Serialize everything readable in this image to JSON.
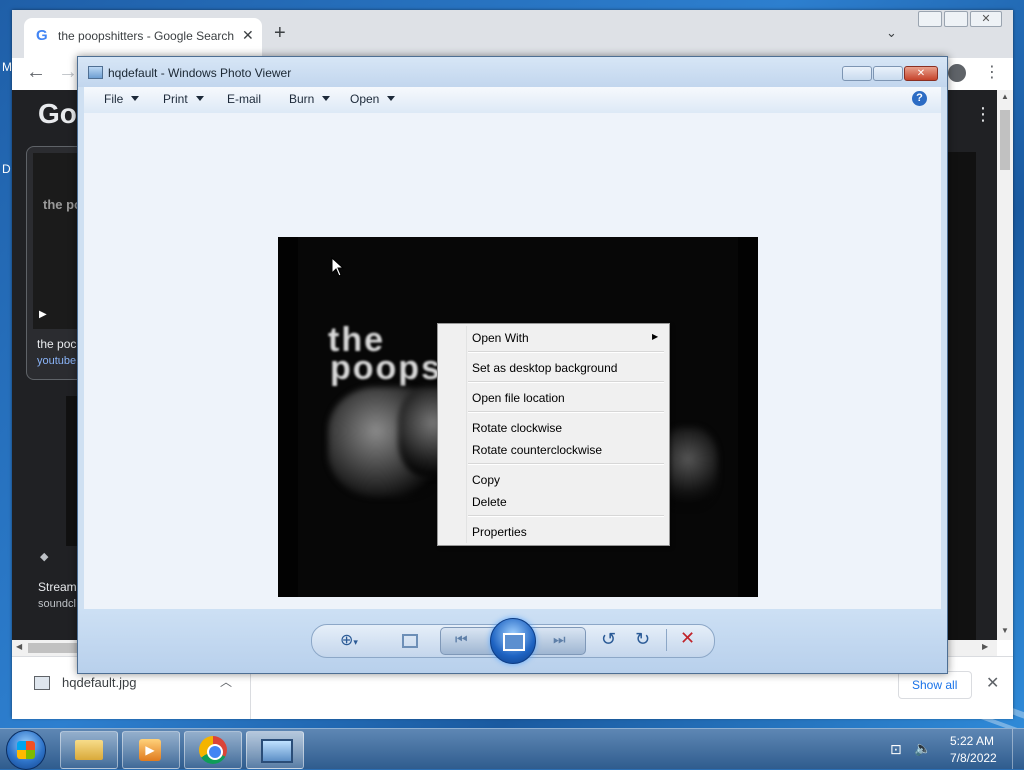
{
  "chrome": {
    "tab_title": "the poopshitters - Google Search",
    "side_labels": {
      "m": "M",
      "d": "D"
    },
    "logo_partial": "Go",
    "results": [
      {
        "title": "the poc",
        "source": "youtube"
      },
      {
        "title": "Stream",
        "source": "soundcl"
      }
    ],
    "thumb_text": "the po",
    "download": {
      "filename": "hqdefault.jpg",
      "show_all": "Show all"
    }
  },
  "photo_viewer": {
    "title": "hqdefault - Windows Photo Viewer",
    "menu": {
      "file": "File",
      "print": "Print",
      "email": "E-mail",
      "burn": "Burn",
      "open": "Open"
    },
    "image_text_line1": "the",
    "image_text_line2": "poopshitters"
  },
  "context_menu": {
    "items": [
      "Open With",
      "Set as desktop background",
      "Open file location",
      "Rotate clockwise",
      "Rotate counterclockwise",
      "Copy",
      "Delete",
      "Properties"
    ]
  },
  "taskbar": {
    "time": "5:22 AM",
    "date": "7/8/2022"
  },
  "colors": {
    "delete_red": "#c0232a",
    "accent_blue": "#1a73e8"
  }
}
